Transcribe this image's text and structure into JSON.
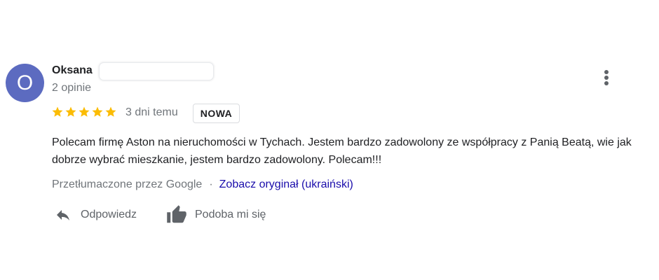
{
  "reviewer": {
    "avatar_letter": "O",
    "avatar_color": "#5c6bc0",
    "name": "Oksana",
    "review_count": "2 opinie"
  },
  "rating": {
    "stars": 5,
    "star_color": "#fbbc04"
  },
  "date": "3 dni temu",
  "badge": "NOWA",
  "review_text": "Polecam firmę Aston na nieruchomości w Tychach. Jestem bardzo zadowolony ze współpracy z Panią Beatą, wie jak dobrze wybrać mieszkanie, jestem bardzo zadowolony. Polecam!!!",
  "translation": {
    "translated_by": "Przetłumaczone przez Google",
    "separator": "·",
    "see_original": "Zobacz oryginał (ukraiński)"
  },
  "actions": {
    "reply_label": "Odpowiedz",
    "like_label": "Podoba mi się"
  },
  "icons": {
    "more": "more-vert-icon",
    "reply": "reply-icon",
    "like": "thumbs-up-icon",
    "star": "star-icon"
  },
  "colors": {
    "link": "#1a0dab",
    "secondary_text": "#70757a",
    "icon_gray": "#5f6368"
  }
}
